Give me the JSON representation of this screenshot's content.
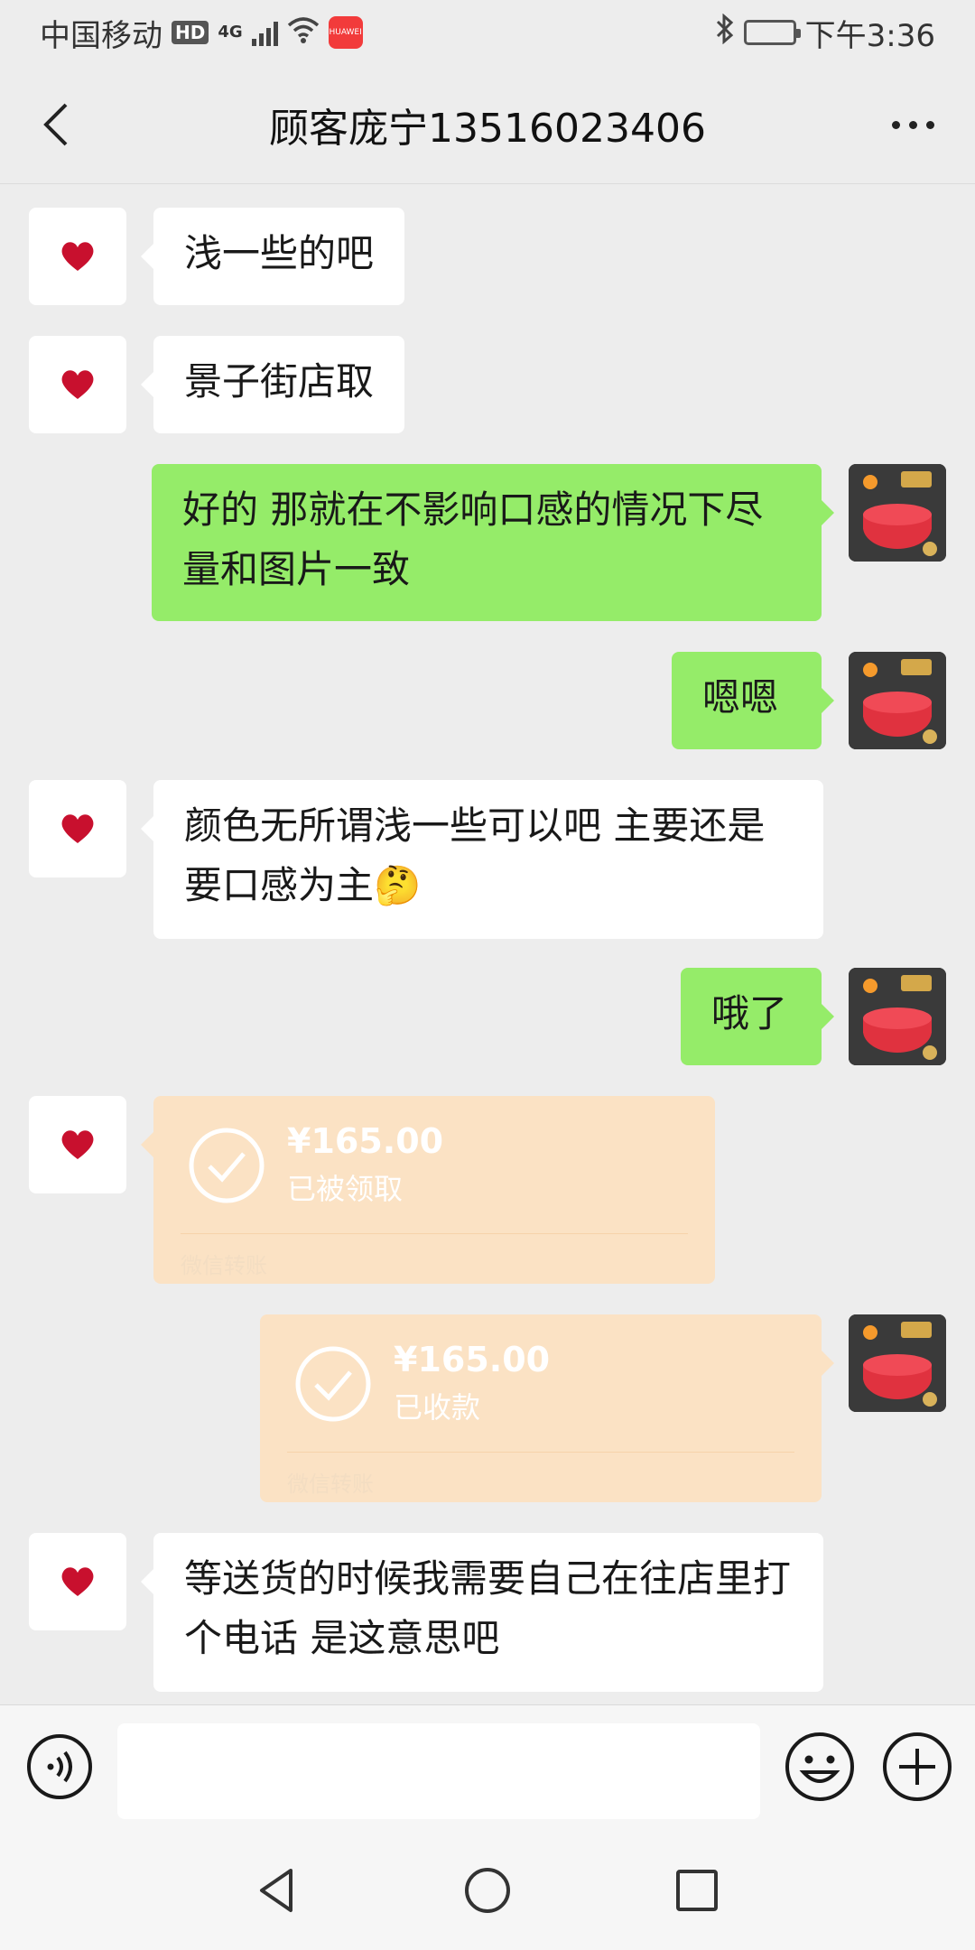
{
  "status_bar": {
    "carrier": "中国移动",
    "hd_badge": "HD",
    "network": "4G",
    "app_badge": "HUAWEI",
    "time": "下午3:36"
  },
  "header": {
    "title": "顾客庞宁13516023406",
    "back_icon": "back-chevron-icon",
    "more_icon": "more-dots-icon"
  },
  "messages": [
    {
      "side": "in",
      "text": "浅一些的吧"
    },
    {
      "side": "in",
      "text": "景子街店取"
    },
    {
      "side": "out",
      "text": "好的  那就在不影响口感的情况下尽量和图片一致"
    },
    {
      "side": "out",
      "text": "嗯嗯"
    },
    {
      "side": "in",
      "text": "颜色无所谓浅一些可以吧  主要还是要口感为主🤔"
    },
    {
      "side": "out",
      "text": "哦了"
    },
    {
      "side": "in",
      "type": "transfer",
      "amount": "¥165.00",
      "status": "已被领取",
      "label": "微信转账"
    },
    {
      "side": "out",
      "type": "transfer",
      "amount": "¥165.00",
      "status": "已收款",
      "label": "微信转账"
    },
    {
      "side": "in",
      "text": "等送货的时候我需要自己在往店里打个电话   是这意思吧"
    }
  ],
  "input_bar": {
    "voice_icon": "voice-icon",
    "input_value": "",
    "emoji_icon": "emoji-icon",
    "plus_icon": "plus-icon"
  },
  "system_nav": {
    "back": "nav-back-icon",
    "home": "nav-home-icon",
    "recent": "nav-recent-icon"
  },
  "colors": {
    "incoming_bubble": "#ffffff",
    "outgoing_bubble": "#95ec69",
    "transfer_bubble": "#fbe2c4",
    "background": "#ededed"
  }
}
